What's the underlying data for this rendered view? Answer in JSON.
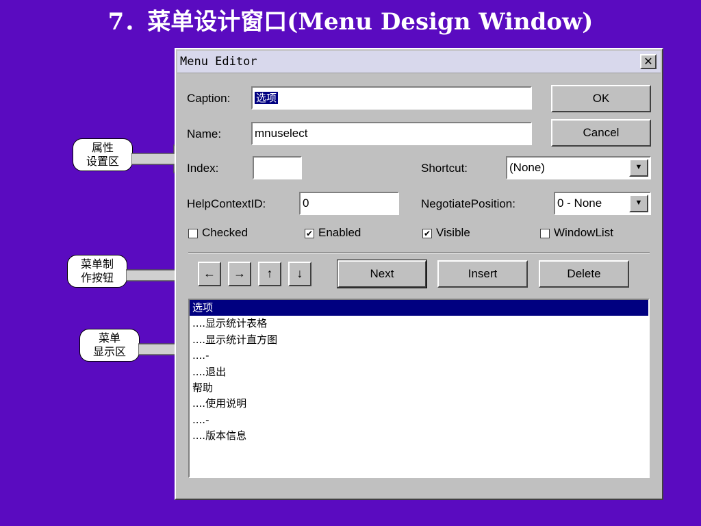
{
  "slide_title": "7．菜单设计窗口(Menu Design Window)",
  "callouts": [
    {
      "text": "属性\n设置区"
    },
    {
      "text": "菜单制\n作按钮"
    },
    {
      "text": "菜单\n显示区"
    }
  ],
  "dialog": {
    "title": "Menu Editor",
    "caption_label": "Caption:",
    "caption_value": "选项",
    "name_label": "Name:",
    "name_value": "mnuselect",
    "index_label": "Index:",
    "index_value": "",
    "shortcut_label": "Shortcut:",
    "shortcut_value": "(None)",
    "helpcontextid_label": "HelpContextID:",
    "helpcontextid_value": "0",
    "negotiate_label": "NegotiatePosition:",
    "negotiate_value": "0 - None",
    "checked_label": "Checked",
    "checked": false,
    "enabled_label": "Enabled",
    "enabled": true,
    "visible_label": "Visible",
    "visible": true,
    "windowlist_label": "WindowList",
    "windowlist": false,
    "ok_label": "OK",
    "cancel_label": "Cancel",
    "next_label": "Next",
    "insert_label": "Insert",
    "delete_label": "Delete",
    "menu_items": [
      "选项",
      "....显示统计表格",
      "....显示统计直方图",
      "....-",
      "....退出",
      "帮助",
      "....使用说明",
      "....-",
      "....版本信息"
    ],
    "selected_index": 0
  }
}
